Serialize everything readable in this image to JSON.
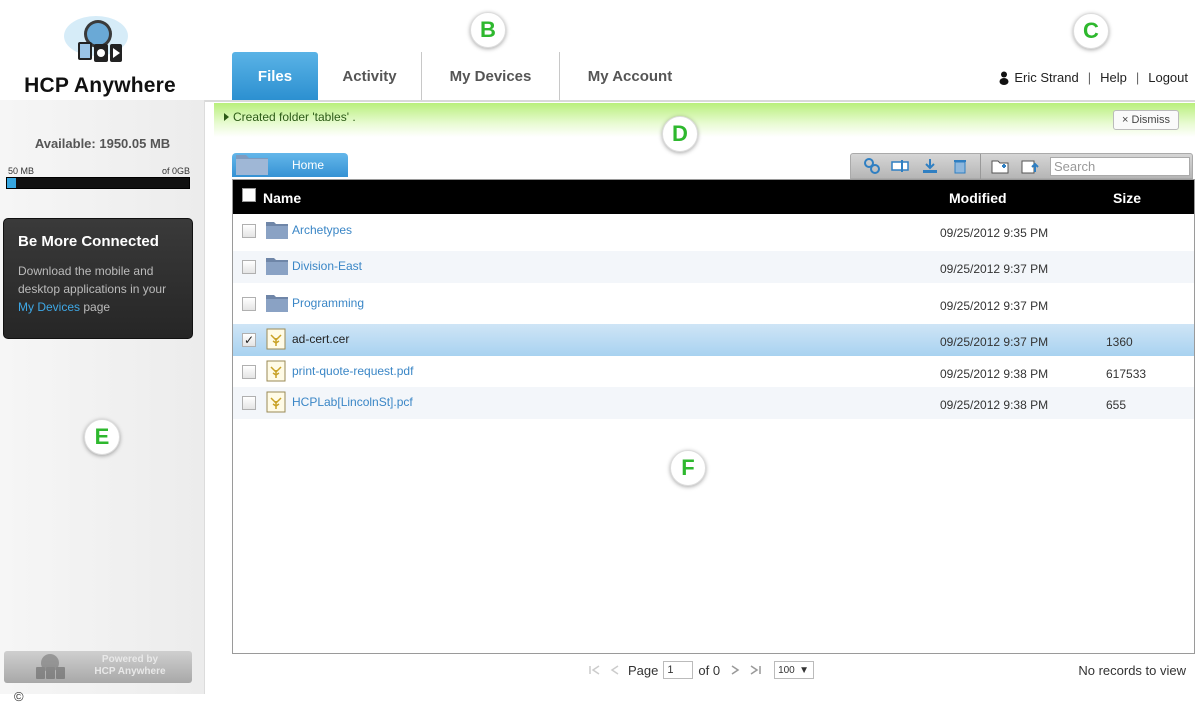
{
  "app": {
    "logo_text": "HCP Anywhere"
  },
  "tabs": [
    {
      "label": "Files",
      "active": true
    },
    {
      "label": "Activity",
      "active": false
    },
    {
      "label": "My Devices",
      "active": false
    },
    {
      "label": "My Account",
      "active": false
    }
  ],
  "user_nav": {
    "user_name": "Eric Strand",
    "separator": "|",
    "help": "Help",
    "logout": "Logout"
  },
  "callouts": [
    "B",
    "C",
    "D",
    "E",
    "F"
  ],
  "notification": {
    "message": "Created folder 'tables' .",
    "dismiss_label": "× Dismiss"
  },
  "sidebar": {
    "available": "Available: 1950.05 MB",
    "quota_left": "50 MB",
    "quota_right": "of 0GB",
    "quota_used_fraction": 0.05,
    "promo_title": "Be More Connected",
    "promo_text_pre": "Download the mobile and desktop applications in your ",
    "promo_link": "My Devices",
    "promo_text_post": " page",
    "powered_line1": "Powered by",
    "powered_line2": "HCP Anywhere",
    "copyright": "©"
  },
  "breadcrumb": {
    "home": "Home"
  },
  "toolbar": {
    "icons": [
      "link-icon",
      "rename-icon",
      "download-icon",
      "delete-icon",
      "new-folder-icon",
      "upload-icon"
    ],
    "search_placeholder": "Search"
  },
  "table": {
    "columns": [
      "Name",
      "Modified",
      "Size"
    ],
    "rows": [
      {
        "type": "folder",
        "name": "Archetypes",
        "modified": "09/25/2012 9:35 PM",
        "size": "",
        "checked": false
      },
      {
        "type": "folder",
        "name": "Division-East",
        "modified": "09/25/2012 9:37 PM",
        "size": "",
        "checked": false
      },
      {
        "type": "folder",
        "name": "Programming",
        "modified": "09/25/2012 9:37 PM",
        "size": "",
        "checked": false
      },
      {
        "type": "file",
        "name": "ad-cert.cer",
        "modified": "09/25/2012 9:37 PM",
        "size": "1360",
        "checked": true
      },
      {
        "type": "file",
        "name": "print-quote-request.pdf",
        "modified": "09/25/2012 9:38 PM",
        "size": "617533",
        "checked": false
      },
      {
        "type": "file",
        "name": "HCPLab[LincolnSt].pcf",
        "modified": "09/25/2012 9:38 PM",
        "size": "655",
        "checked": false
      }
    ]
  },
  "pager": {
    "page_label": "Page",
    "page_value": "1",
    "of_label": "of 0",
    "per_page": "100",
    "records_text": "No records to view"
  },
  "colors": {
    "accent_blue": "#2b8fd0",
    "callout_green": "#2eb82e",
    "notify_green": "#b9ef7c",
    "link_blue": "#3a86c6"
  }
}
